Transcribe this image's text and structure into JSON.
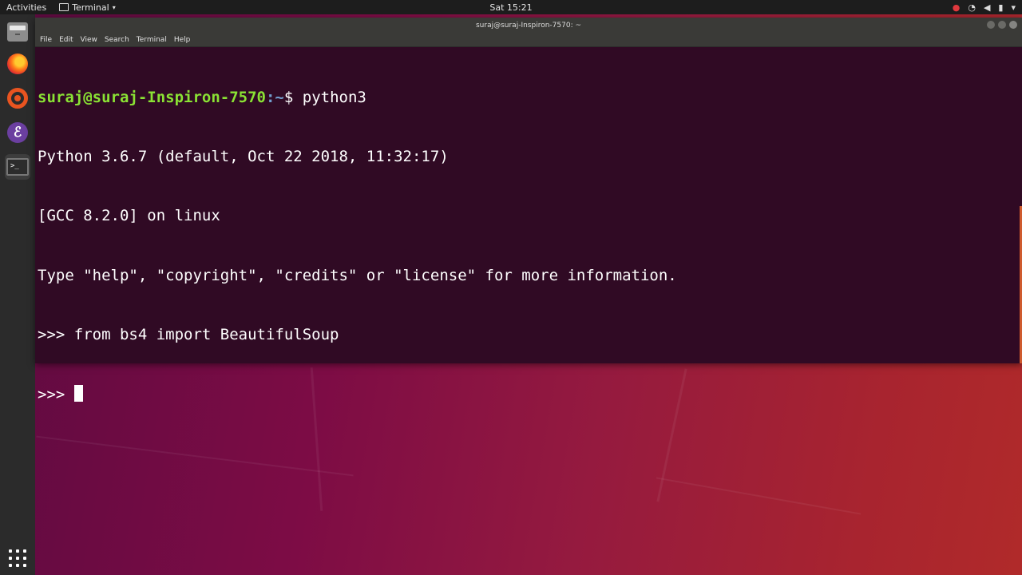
{
  "top_panel": {
    "activities": "Activities",
    "app_menu_label": "Terminal",
    "clock": "Sat 15:21",
    "tray_icons": [
      "camera-record-icon",
      "wifi-icon",
      "volume-icon",
      "battery-icon",
      "power-menu-icon"
    ]
  },
  "dock": {
    "items": [
      "files",
      "firefox",
      "ubuntu-software",
      "emacs",
      "terminal"
    ],
    "active": "terminal"
  },
  "terminal": {
    "title": "suraj@suraj-Inspiron-7570: ~",
    "menu": [
      "File",
      "Edit",
      "View",
      "Search",
      "Terminal",
      "Help"
    ],
    "prompt_user": "suraj@suraj-Inspiron-7570",
    "prompt_path": ":~",
    "prompt_symbol": "$",
    "command": " python3",
    "lines": [
      "Python 3.6.7 (default, Oct 22 2018, 11:32:17)",
      "[GCC 8.2.0] on linux",
      "Type \"help\", \"copyright\", \"credits\" or \"license\" for more information.",
      ">>> from bs4 import BeautifulSoup"
    ],
    "current_prompt": ">>> "
  },
  "colors": {
    "terminal_bg": "#300a24",
    "prompt_user": "#8ae234",
    "prompt_path": "#729fcf"
  }
}
